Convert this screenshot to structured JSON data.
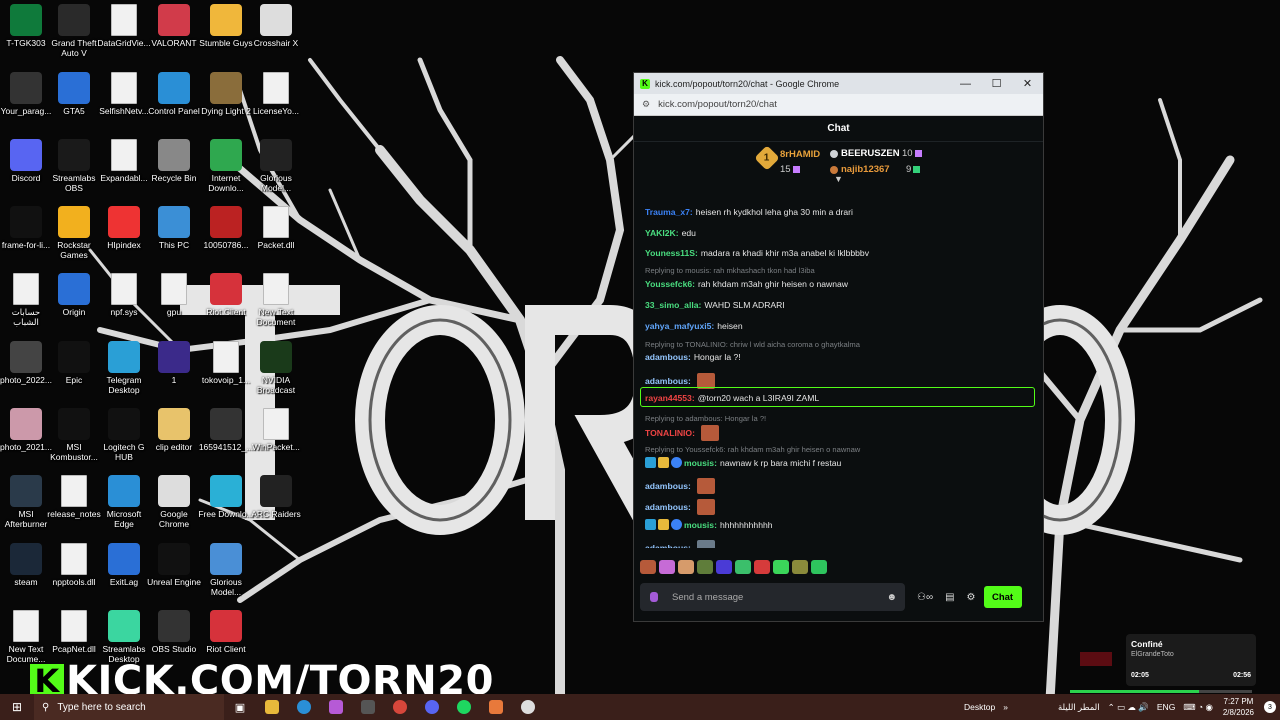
{
  "desktop_icons": [
    {
      "label": "T-TGK303"
    },
    {
      "label": "Grand Theft Auto V"
    },
    {
      "label": "DataGridVie..."
    },
    {
      "label": "VALORANT"
    },
    {
      "label": "Stumble Guys"
    },
    {
      "label": "Crosshair X"
    },
    {
      "label": "Your_parag..."
    },
    {
      "label": "GTA5"
    },
    {
      "label": "SelfishNetv..."
    },
    {
      "label": "Control Panel"
    },
    {
      "label": "Dying Light 2"
    },
    {
      "label": "LicenseYo..."
    },
    {
      "label": "Discord"
    },
    {
      "label": "Streamlabs OBS"
    },
    {
      "label": "Expandabl..."
    },
    {
      "label": "Recycle Bin"
    },
    {
      "label": "Internet Downlo..."
    },
    {
      "label": "Glorious Model..."
    },
    {
      "label": "frame-for-li..."
    },
    {
      "label": "Rockstar Games"
    },
    {
      "label": "HIpindex"
    },
    {
      "label": "This PC"
    },
    {
      "label": "10050786..."
    },
    {
      "label": "Packet.dll"
    },
    {
      "label": "حسابات الشباب"
    },
    {
      "label": "Origin"
    },
    {
      "label": "npf.sys"
    },
    {
      "label": "gpu"
    },
    {
      "label": "Riot Client"
    },
    {
      "label": "New Text Document"
    },
    {
      "label": "photo_2022..."
    },
    {
      "label": "Epic"
    },
    {
      "label": "Telegram Desktop"
    },
    {
      "label": "1"
    },
    {
      "label": "tokovoip_1..."
    },
    {
      "label": "NVIDIA Broadcast"
    },
    {
      "label": "photo_2021..."
    },
    {
      "label": "MSI Kombustor..."
    },
    {
      "label": "Logitech G HUB"
    },
    {
      "label": "clip editor"
    },
    {
      "label": "165941512_..."
    },
    {
      "label": "WinPacket..."
    },
    {
      "label": "MSI Afterburner"
    },
    {
      "label": "release_notes"
    },
    {
      "label": "Microsoft Edge"
    },
    {
      "label": "Google Chrome"
    },
    {
      "label": "Free Downlo..."
    },
    {
      "label": "ARC Raiders"
    },
    {
      "label": "steam"
    },
    {
      "label": "npptools.dll"
    },
    {
      "label": "ExitLag"
    },
    {
      "label": "Unreal Engine"
    },
    {
      "label": "Glorious Model..."
    },
    {
      "label": "New Text Docume..."
    },
    {
      "label": "PcapNet.dll"
    },
    {
      "label": "Streamlabs Desktop"
    },
    {
      "label": "OBS Studio"
    },
    {
      "label": "Riot Client"
    }
  ],
  "overlay_text": "KICK.COM/TORN20",
  "chrome": {
    "title": "kick.com/popout/torn20/chat - Google Chrome",
    "url": "kick.com/popout/torn20/chat",
    "minimize": "—",
    "maximize": "☐",
    "close": "✕"
  },
  "chat": {
    "header": "Chat",
    "leaderboard": {
      "first": {
        "rank": "1",
        "name": "8rHAMID",
        "score": "15"
      },
      "second": {
        "name": "BEERUSZEN",
        "score": "10"
      },
      "third": {
        "name": "najib12367",
        "score": "9"
      }
    },
    "messages": [
      {
        "user": "Trauma_x7",
        "color": "#3b82f6",
        "text": "heisen rh kydkhol leha gha 30 min a drari"
      },
      {
        "user": "YAKI2K",
        "color": "#4ade80",
        "text": "edu"
      },
      {
        "user": "Youness11S",
        "color": "#4ade80",
        "text": "madara ra khadi khir m3a anabel ki lklbbbbv"
      },
      {
        "reply": "Replying to mousis: rah mkhashach tkon had l3iba"
      },
      {
        "user": "Youssefck6",
        "color": "#4ade80",
        "text": "rah khdam m3ah ghir heisen o nawnaw"
      },
      {
        "user": "33_simo_alla",
        "color": "#4ade80",
        "text": "WAHD SLM ADRARI"
      },
      {
        "user": "yahya_mafyuxi5",
        "color": "#60a5fa",
        "text": "heisen"
      },
      {
        "reply": "Replying to TONALINIO: chriw l wld aicha coroma o ghaytkalma"
      },
      {
        "user": "adambous",
        "color": "#93c5fd",
        "text": "Hongar la ?!"
      },
      {
        "user": "adambous",
        "color": "#93c5fd",
        "text": ""
      },
      {
        "user": "rayan44553",
        "color": "#ef4444",
        "text": "@torn20 wach a L3IRA9I ZAML"
      },
      {
        "reply": "Replying to adambous: Hongar la ?!"
      },
      {
        "user": "TONALINIO",
        "color": "#ef4444",
        "text": ""
      },
      {
        "reply": "Replying to Youssefck6: rah khdam m3ah ghir heisen o nawnaw"
      },
      {
        "user": "mousis",
        "color": "#4ade80",
        "text": "nawnaw k rp bara michi f restau"
      },
      {
        "user": "adambous",
        "color": "#93c5fd",
        "text": ""
      },
      {
        "user": "adambous",
        "color": "#93c5fd",
        "text": ""
      },
      {
        "user": "mousis",
        "color": "#4ade80",
        "text": "hhhhhhhhhhh"
      },
      {
        "user": "adambous",
        "color": "#93c5fd",
        "text": ""
      }
    ],
    "input_placeholder": "Send a message",
    "send_label": "Chat"
  },
  "media": {
    "title": "Confiné",
    "artist": "ElGrandeToto",
    "elapsed": "02:05",
    "duration": "02:56",
    "progress": 0.71
  },
  "taskbar": {
    "search_placeholder": "Type here to search",
    "desktop_label": "Desktop",
    "weather": "المطر الليلة",
    "language": "ENG",
    "time": "7:27 PM",
    "date": "2/8/2026",
    "notification_count": "3"
  },
  "colors": {
    "kick_green": "#53fc18",
    "taskbar": "#3a1f1a"
  }
}
